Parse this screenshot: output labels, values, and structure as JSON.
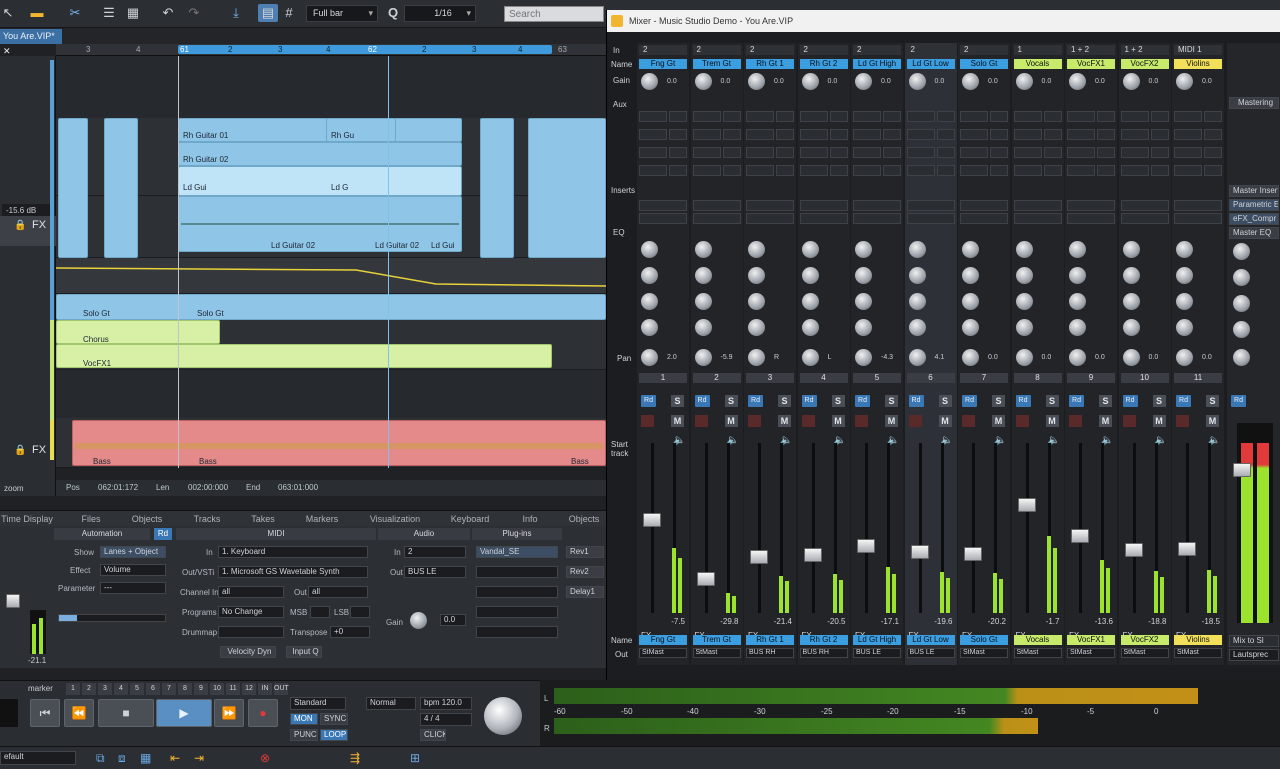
{
  "toolbar": {
    "zoom_mode": "Full bar",
    "grid_symbol": "#",
    "quantize": "Q",
    "quantize_value": "1/16",
    "search_placeholder": "Search"
  },
  "project": {
    "tab": "You Are.VIP*"
  },
  "ruler": {
    "marks": [
      "3",
      "4",
      "61",
      "2",
      "3",
      "4",
      "62",
      "2",
      "3",
      "4",
      "63"
    ]
  },
  "clips": {
    "rh1": "Rh Guitar 01",
    "rh2": "Rh Guitar 02",
    "rhg": "Rh Gu",
    "ldg": "Ld Gui",
    "ldg2": "Ld G",
    "ldg02": "Ld Guitar 02",
    "ldg02b": "Ld Guitar 02",
    "ldgui": "Ld Gui",
    "solo1": "Solo Gt",
    "solo2": "Solo Gt",
    "chorus": "Chorus",
    "vocfx": "VocFX1",
    "bass1": "Bass",
    "bass2": "Bass",
    "bass3": "Bass"
  },
  "trackhdr": {
    "vol": "-15.6 dB",
    "fx": "FX",
    "fx2": "FX"
  },
  "status": {
    "pos_label": "Pos",
    "pos": "062:01:172",
    "len_label": "Len",
    "len": "002:00:000",
    "end_label": "End",
    "end": "063:01:000",
    "zoom": "zoom"
  },
  "panel_tabs": [
    "Time Display",
    "Files",
    "Objects",
    "Tracks",
    "Takes",
    "Markers",
    "Visualization",
    "Keyboard",
    "Info",
    "Objects"
  ],
  "inspector": {
    "automation": "Automation",
    "rd": "Rd",
    "midi": "MIDI",
    "audio": "Audio",
    "plugins": "Plug-ins",
    "show_label": "Show",
    "show_val": "Lanes + Object",
    "effect_label": "Effect",
    "effect_val": "Volume",
    "param_label": "Parameter",
    "param_val": "---",
    "in_label": "In",
    "in_val": "1. Keyboard",
    "outvsti_label": "Out/VSTi",
    "outvsti_val": "1. Microsoft GS Wavetable Synth",
    "chin_label": "Channel In",
    "chin_val": "all",
    "out_label": "Out",
    "out_val": "all",
    "programs_label": "Programs",
    "programs_val": "No Change",
    "msb_label": "MSB",
    "lsb_label": "LSB",
    "drummap_label": "Drummap",
    "transpose_label": "Transpose",
    "transpose_val": "+0",
    "velocity_btn": "Velocity Dyn",
    "inputq_btn": "Input Q",
    "ain_label": "In",
    "ain_val": "2",
    "aout_label": "Out",
    "aout_val": "BUS LE",
    "gain_label": "Gain",
    "gain_val": "0.0",
    "plugin1": "Vandal_SE",
    "rev": "Rev1",
    "rev2": "Rev2",
    "delay": "Delay1",
    "vol_db": "-21.1"
  },
  "transport": {
    "marker": "marker",
    "marker_nums": [
      "1",
      "2",
      "3",
      "4",
      "5",
      "6",
      "7",
      "8",
      "9",
      "10",
      "11",
      "12",
      "IN",
      "OUT"
    ],
    "standard": "Standard",
    "normal": "Normal",
    "bpm": "bpm 120.0",
    "sig": "4 / 4",
    "mon": "MON",
    "sync": "SYNC",
    "punch": "PUNCH",
    "loop": "LOOP",
    "click": "CLICK"
  },
  "meter": {
    "labels": [
      "-60",
      "-50",
      "-40",
      "-30",
      "-25",
      "-20",
      "-15",
      "-10",
      "-5",
      "0"
    ],
    "l": "L",
    "r": "R"
  },
  "bottom": {
    "default": "efault"
  },
  "mixer": {
    "title": "Mixer - Music Studio Demo - You Are.VIP",
    "row_labels": {
      "in": "In",
      "name": "Name",
      "gain": "Gain",
      "aux": "Aux",
      "inserts": "Inserts",
      "eq": "EQ",
      "pan": "Pan",
      "start_track": "Start track",
      "name2": "Name",
      "out": "Out"
    },
    "mastering": "Mastering",
    "master_inserts": "Master Inserts",
    "master_eq": "Master EQ",
    "param_eq": "Parametric EQ",
    "efx_comp": "eFX_Compr",
    "mix_to": "Mix to Sl",
    "lautsprec": "Lautsprec",
    "strips": [
      {
        "num": "1",
        "name": "Fng Gt",
        "in": "2",
        "color": "#3b9ee0",
        "gain": "0.0",
        "fader": "-7.5",
        "out": "StMast",
        "pan": "2.0"
      },
      {
        "num": "2",
        "name": "Trem Gt",
        "in": "2",
        "color": "#3b9ee0",
        "gain": "0.0",
        "fader": "-29.8",
        "out": "StMast",
        "pan": "-5.9"
      },
      {
        "num": "3",
        "name": "Rh Gt 1",
        "in": "2",
        "color": "#3b9ee0",
        "gain": "0.0",
        "fader": "-21.4",
        "out": "BUS RH",
        "pan": "R"
      },
      {
        "num": "4",
        "name": "Rh Gt 2",
        "in": "2",
        "color": "#3b9ee0",
        "gain": "0.0",
        "fader": "-20.5",
        "out": "BUS RH",
        "pan": "L"
      },
      {
        "num": "5",
        "name": "Ld Gt High",
        "in": "2",
        "color": "#3b9ee0",
        "gain": "0.0",
        "fader": "-17.1",
        "out": "BUS LE",
        "pan": "-4.3"
      },
      {
        "num": "6",
        "name": "Ld Gt Low",
        "in": "2",
        "color": "#3b9ee0",
        "gain": "0.0",
        "fader": "-19.6",
        "out": "BUS LE",
        "pan": "4.1"
      },
      {
        "num": "7",
        "name": "Solo Gt",
        "in": "2",
        "color": "#3b9ee0",
        "gain": "0.0",
        "fader": "-20.2",
        "out": "StMast",
        "pan": "0.0"
      },
      {
        "num": "8",
        "name": "Vocals",
        "in": "1",
        "color": "#c7ea6b",
        "gain": "0.0",
        "fader": "-1.7",
        "out": "StMast",
        "pan": "0.0"
      },
      {
        "num": "9",
        "name": "VocFX1",
        "in": "1 + 2",
        "color": "#c7ea6b",
        "gain": "0.0",
        "fader": "-13.6",
        "out": "StMast",
        "pan": "0.0"
      },
      {
        "num": "10",
        "name": "VocFX2",
        "in": "1 + 2",
        "color": "#c7ea6b",
        "gain": "0.0",
        "fader": "-18.8",
        "out": "StMast",
        "pan": "0.0"
      },
      {
        "num": "11",
        "name": "Violins",
        "in": "MIDI 1",
        "color": "#f2e05a",
        "gain": "0.0",
        "fader": "-18.5",
        "out": "StMast",
        "pan": "0.0"
      }
    ]
  }
}
